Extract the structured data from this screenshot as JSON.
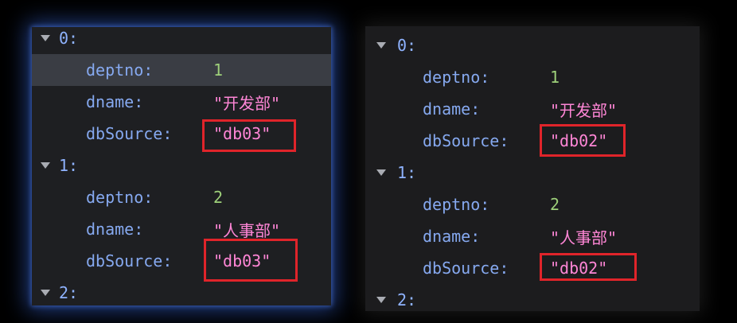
{
  "left_panel": {
    "items": [
      {
        "index": "0:",
        "deptno_key": "deptno:",
        "deptno": "1",
        "dname_key": "dname:",
        "dname": "\"开发部\"",
        "dbsource_key": "dbSource:",
        "dbsource": "\"db03\""
      },
      {
        "index": "1:",
        "deptno_key": "deptno:",
        "deptno": "2",
        "dname_key": "dname:",
        "dname": "\"人事部\"",
        "dbsource_key": "dbSource:",
        "dbsource": "\"db03\""
      },
      {
        "index": "2:"
      }
    ]
  },
  "right_panel": {
    "items": [
      {
        "index": "0:",
        "deptno_key": "deptno:",
        "deptno": "1",
        "dname_key": "dname:",
        "dname": "\"开发部\"",
        "dbsource_key": "dbSource:",
        "dbsource": "\"db02\""
      },
      {
        "index": "1:",
        "deptno_key": "deptno:",
        "deptno": "2",
        "dname_key": "dname:",
        "dname": "\"人事部\"",
        "dbsource_key": "dbSource:",
        "dbsource": "\"db02\""
      },
      {
        "index": "2:"
      }
    ]
  },
  "colors": {
    "panel_bg": "#1e1f22",
    "index": "#8fb3ff",
    "key": "#86a9f0",
    "number": "#9ed07a",
    "string": "#ff86d6",
    "highlight": "#e0242a",
    "selection": "#3a3d44"
  },
  "icons": {
    "expander": "disclosure-triangle-down-icon"
  }
}
